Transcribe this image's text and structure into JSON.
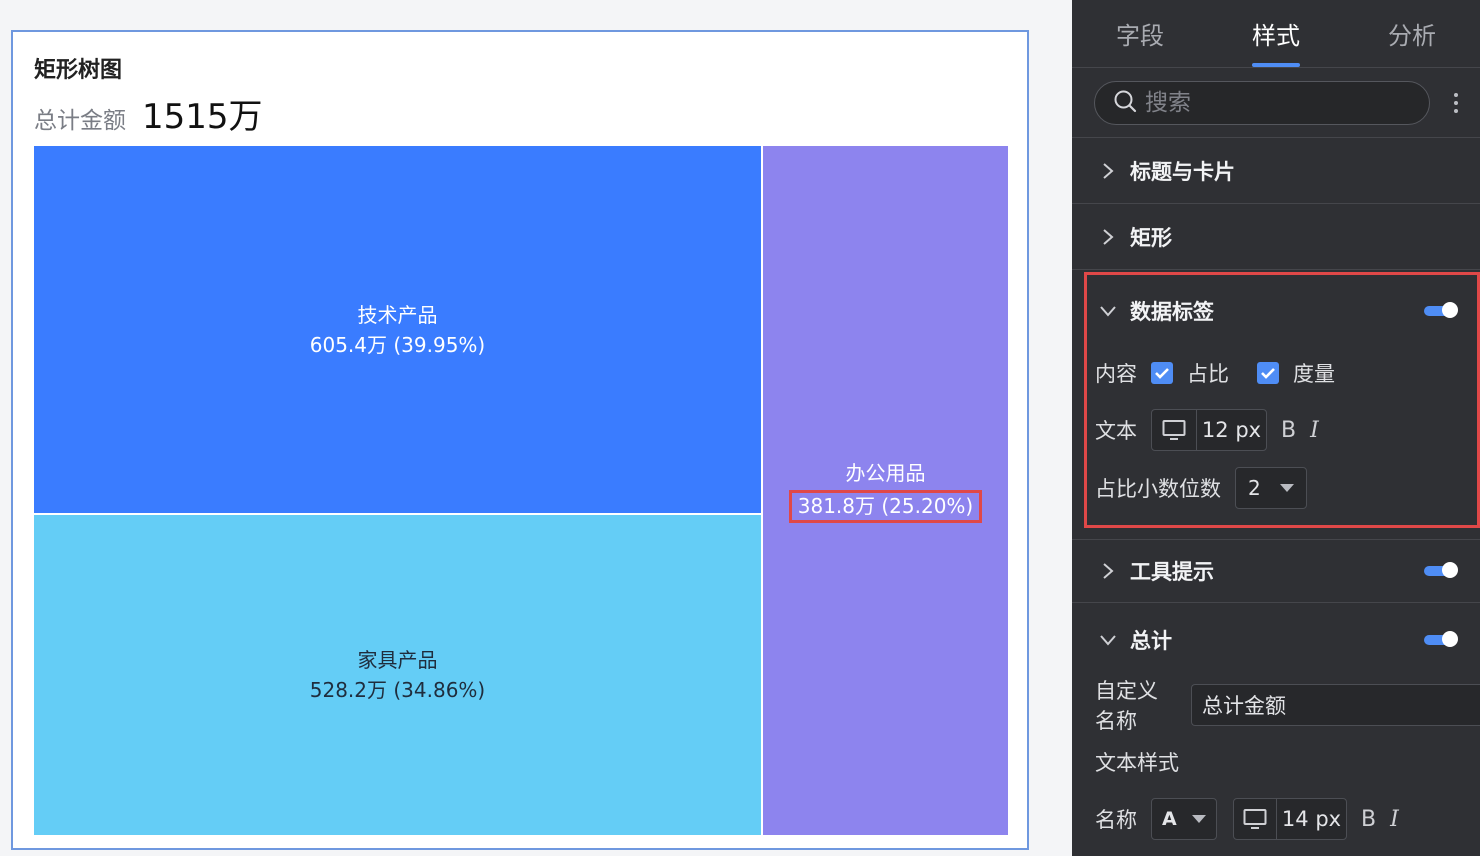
{
  "card": {
    "title": "矩形树图",
    "total_label": "总计金额",
    "total_value": "1515万"
  },
  "chart_data": {
    "type": "treemap",
    "title": "矩形树图",
    "items": [
      {
        "name": "技术产品",
        "value": 605.4,
        "percent": 39.95,
        "label": "605.4万 (39.95%)",
        "color": "#3a7cff"
      },
      {
        "name": "家具产品",
        "value": 528.2,
        "percent": 34.86,
        "label": "528.2万 (34.86%)",
        "color": "#64cdf6"
      },
      {
        "name": "办公用品",
        "value": 381.8,
        "percent": 25.2,
        "label": "381.8万 (25.20%)",
        "color": "#8d84ee"
      }
    ]
  },
  "panel": {
    "tabs": [
      {
        "label": "字段"
      },
      {
        "label": "样式",
        "active": true
      },
      {
        "label": "分析"
      }
    ],
    "search": {
      "placeholder": "搜索"
    },
    "sections": {
      "title_card": "标题与卡片",
      "rect": "矩形",
      "data_label": {
        "title": "数据标签",
        "enabled": true,
        "content_label": "内容",
        "opt_ratio": "占比",
        "opt_measure": "度量",
        "text_label": "文本",
        "text_size": "12 px",
        "bold": "B",
        "italic": "I",
        "decimal_label": "占比小数位数",
        "decimal_value": "2"
      },
      "tooltip": {
        "title": "工具提示",
        "enabled": true
      },
      "total": {
        "title": "总计",
        "enabled": true,
        "name_label": "自定义名称",
        "name_value": "总计金额",
        "text_style_label": "文本样式",
        "name_row_label": "名称",
        "font_option": "A",
        "font_size": "14 px",
        "bold": "B",
        "italic": "I"
      }
    }
  },
  "colors": {
    "accent": "#4f8df5",
    "highlight": "#e04848",
    "panel_bg": "#2f3034"
  }
}
